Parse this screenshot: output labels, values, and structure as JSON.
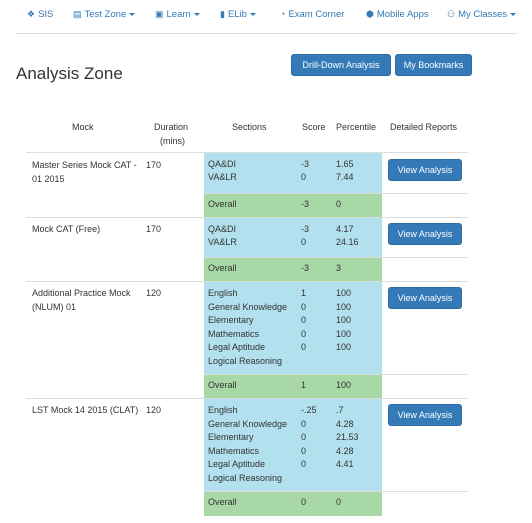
{
  "nav": {
    "items": [
      {
        "icon": "home-icon",
        "glyph": "❖",
        "label": "SIS",
        "caret": false
      },
      {
        "icon": "file-icon",
        "glyph": "▤",
        "label": "Test Zone",
        "caret": true
      },
      {
        "icon": "book-icon",
        "glyph": "▣",
        "label": "Learn",
        "caret": true
      },
      {
        "icon": "elib-icon",
        "glyph": "▮",
        "label": "ELib",
        "caret": true
      },
      {
        "icon": "pie-chart-icon",
        "glyph": "◔",
        "label": "Exam Corner",
        "caret": false
      },
      {
        "icon": "android-icon",
        "glyph": "⬢",
        "label": "Mobile Apps",
        "caret": false
      },
      {
        "icon": "users-icon",
        "glyph": "⚇",
        "label": "My Classes",
        "caret": true
      }
    ]
  },
  "page": {
    "title": "Analysis Zone",
    "drilldown_label": "Drill-Down Analysis",
    "bookmarks_label": "My Bookmarks"
  },
  "table": {
    "headers": {
      "mock": "Mock",
      "duration_line1": "Duration",
      "duration_line2": "(mins)",
      "sections": "Sections",
      "score": "Score",
      "percentile": "Percentile",
      "reports": "Detailed Reports"
    },
    "rows": [
      {
        "mock": "Master Series Mock CAT - 01 2015",
        "duration": "170",
        "sections": [
          "QA&DI",
          "VA&LR"
        ],
        "scores": [
          "-3",
          "0"
        ],
        "percentiles": [
          "1.65",
          "7.44"
        ],
        "overall_label": "Overall",
        "overall_score": "-3",
        "overall_percentile": "0",
        "action": "View Analysis"
      },
      {
        "mock": "Mock CAT (Free)",
        "duration": "170",
        "sections": [
          "QA&DI",
          "VA&LR"
        ],
        "scores": [
          "-3",
          "0"
        ],
        "percentiles": [
          "4.17",
          "24.16"
        ],
        "overall_label": "Overall",
        "overall_score": "-3",
        "overall_percentile": "3",
        "action": "View Analysis"
      },
      {
        "mock": "Additional Practice Mock (NLUM) 01",
        "duration": "120",
        "sections": [
          "English",
          "General Knowledge",
          "Elementary",
          "Mathematics",
          "Legal Aptitude",
          "Logical Reasoning"
        ],
        "scores": [
          "1",
          "0",
          "0",
          "0",
          "0",
          ""
        ],
        "percentiles": [
          "100",
          "100",
          "100",
          "100",
          "100",
          ""
        ],
        "overall_label": "Overall",
        "overall_score": "1",
        "overall_percentile": "100",
        "action": "View Analysis"
      },
      {
        "mock": "LST Mock 14 2015 (CLAT)",
        "duration": "120",
        "sections": [
          "English",
          "General Knowledge",
          "Elementary",
          "Mathematics",
          "Legal Aptitude",
          "Logical Reasoning"
        ],
        "scores": [
          "-.25",
          "0",
          "0",
          "0",
          "0",
          ""
        ],
        "percentiles": [
          ".7",
          "4.28",
          "21.53",
          "4.28",
          "4.41",
          ""
        ],
        "overall_label": "Overall",
        "overall_score": "0",
        "overall_percentile": "0",
        "action": "View Analysis"
      }
    ]
  },
  "colors": {
    "primary": "#337ab7",
    "section_blue": "#b3e0ee",
    "overall_green": "#a8d8a5"
  }
}
